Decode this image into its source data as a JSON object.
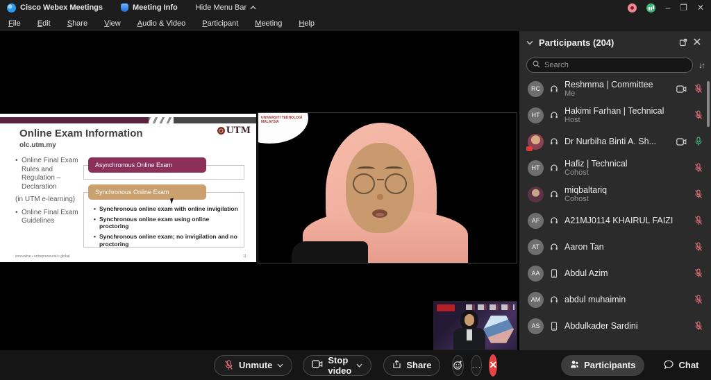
{
  "title_bar": {
    "app_title": "Cisco Webex Meetings",
    "meeting_info": "Meeting Info",
    "hide_menu_bar": "Hide Menu Bar"
  },
  "menu_bar": {
    "items": [
      {
        "label": "File"
      },
      {
        "label": "Edit"
      },
      {
        "label": "Share"
      },
      {
        "label": "View"
      },
      {
        "label": "Audio & Video"
      },
      {
        "label": "Participant"
      },
      {
        "label": "Meeting"
      },
      {
        "label": "Help"
      }
    ]
  },
  "slide": {
    "title": "Online Exam Information",
    "subtitle": "olc.utm.my",
    "logo_text": "UTM",
    "left_items": [
      {
        "text": "Online Final Exam Rules and Regulation – Declaration"
      },
      {
        "text": "(in UTM e-learning)"
      },
      {
        "text": "Online Final Exam Guidelines"
      }
    ],
    "async_box_label": "Asynchronous Online Exam",
    "sync_box_label": "Synchronous Online Exam",
    "sync_bullets": [
      "Synchronous online exam with online invigilation",
      "Synchronous online exam using online proctoring",
      "Synchronous online exam; no invigilation and no proctoring"
    ],
    "footer": "innovative • entrepreneurial • global",
    "page_number": "11"
  },
  "video": {
    "corner_text": "UNIVERSITI TEKNOLOGI MALAYSIA"
  },
  "participants_panel": {
    "title": "Participants (204)",
    "search_placeholder": "Search",
    "participants": [
      {
        "initials": "RC",
        "name": "Reshmma | Committee",
        "role": "Me",
        "device": "headset",
        "video": true,
        "mic": "muted",
        "avatar": ""
      },
      {
        "initials": "HT",
        "name": "Hakimi Farhan | Technical",
        "role": "Host",
        "device": "headset",
        "video": false,
        "mic": "muted",
        "avatar": ""
      },
      {
        "initials": "",
        "name": "Dr Nurbiha Binti A. Sh...",
        "role": "",
        "device": "headset",
        "video": true,
        "mic": "on",
        "avatar": "photo1"
      },
      {
        "initials": "HT",
        "name": "Hafiz | Technical",
        "role": "Cohost",
        "device": "headset",
        "video": false,
        "mic": "muted",
        "avatar": ""
      },
      {
        "initials": "",
        "name": "miqbaltariq",
        "role": "Cohost",
        "device": "headset",
        "video": false,
        "mic": "muted",
        "avatar": "photo2"
      },
      {
        "initials": "AF",
        "name": "A21MJ0114 KHAIRUL FAIZI",
        "role": "",
        "device": "headset",
        "video": false,
        "mic": "muted",
        "avatar": ""
      },
      {
        "initials": "AT",
        "name": "Aaron Tan",
        "role": "",
        "device": "headset",
        "video": false,
        "mic": "muted",
        "avatar": ""
      },
      {
        "initials": "AA",
        "name": "Abdul Azim",
        "role": "",
        "device": "phone",
        "video": false,
        "mic": "muted",
        "avatar": ""
      },
      {
        "initials": "AM",
        "name": "abdul muhaimin",
        "role": "",
        "device": "headset",
        "video": false,
        "mic": "muted",
        "avatar": ""
      },
      {
        "initials": "AS",
        "name": "Abdulkader Sardini",
        "role": "",
        "device": "phone",
        "video": false,
        "mic": "muted",
        "avatar": ""
      }
    ]
  },
  "bottom_bar": {
    "unmute_label": "Unmute",
    "stop_video_label": "Stop video",
    "share_label": "Share",
    "participants_label": "Participants",
    "chat_label": "Chat",
    "more_dots": "...",
    "colors": {
      "end_button": "#e64343",
      "muted_mic": "#d36a72",
      "active_mic": "#43b581"
    }
  }
}
